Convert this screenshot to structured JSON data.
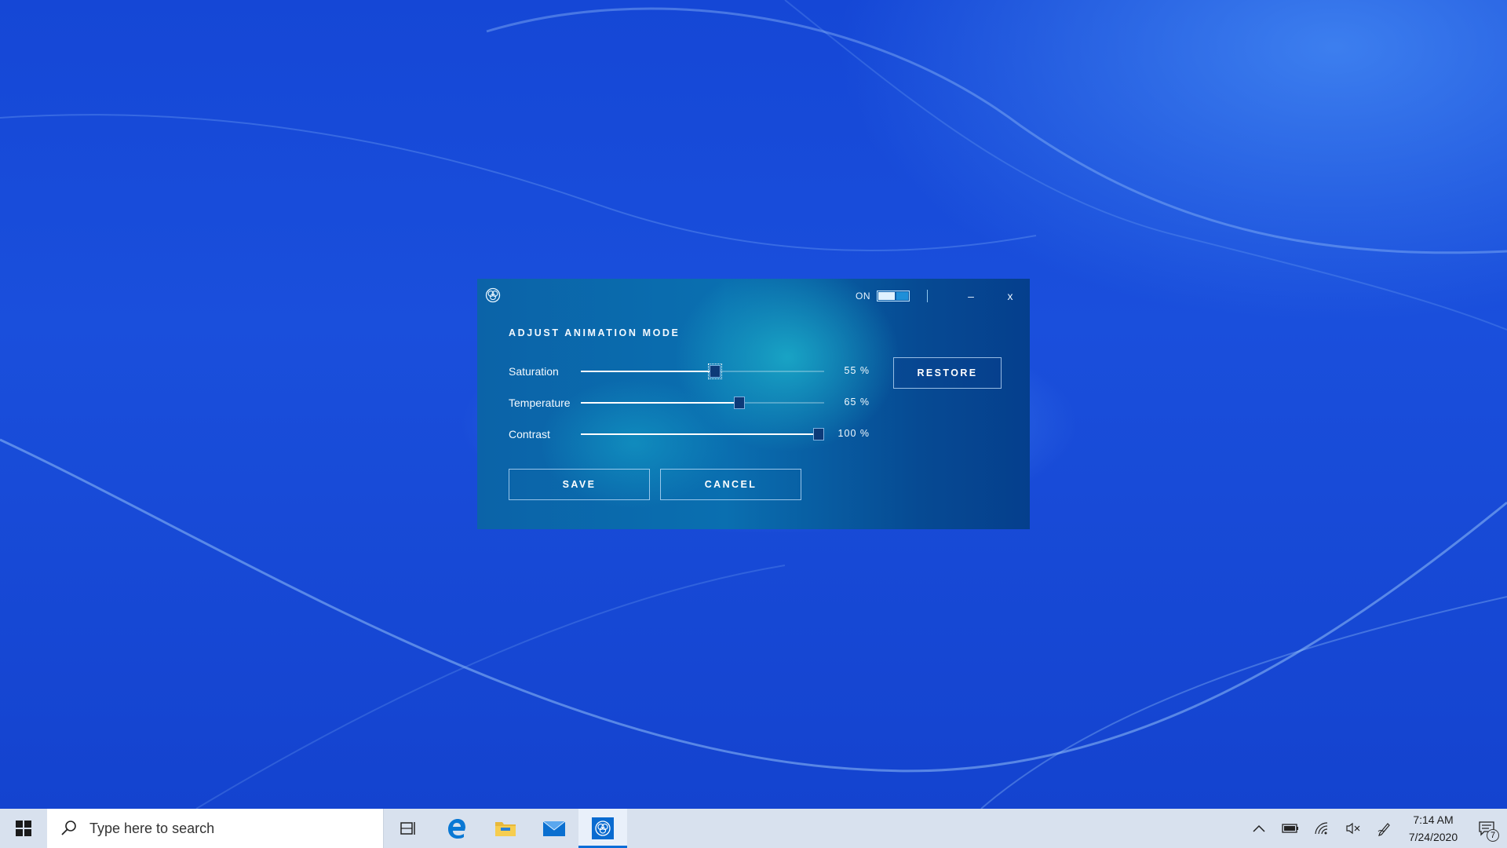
{
  "app": {
    "power_label": "ON",
    "power_on": true,
    "minimize_glyph": "–",
    "close_glyph": "x",
    "heading": "ADJUST ANIMATION MODE",
    "sliders": [
      {
        "label": "Saturation",
        "value": 55,
        "display": "55 %",
        "focused": true
      },
      {
        "label": "Temperature",
        "value": 65,
        "display": "65 %",
        "focused": false
      },
      {
        "label": "Contrast",
        "value": 100,
        "display": "100 %",
        "focused": false
      }
    ],
    "restore_label": "RESTORE",
    "save_label": "SAVE",
    "cancel_label": "CANCEL"
  },
  "taskbar": {
    "search_placeholder": "Type here to search",
    "pinned": [
      "task-view-icon",
      "edge-browser-icon",
      "file-explorer-icon",
      "mail-icon",
      "animation-app-icon"
    ],
    "active_app": "animation-app-icon",
    "tray_icons": [
      "chevron-up-icon",
      "battery-icon",
      "wifi-icon",
      "volume-muted-icon",
      "pen-icon"
    ],
    "time": "7:14 AM",
    "date": "7/24/2020",
    "notification_count": "7"
  },
  "colors": {
    "desktop_blue": "#1547d6",
    "window_teal": "#0a6fb0",
    "taskbar_bg": "#d8e1ee",
    "active_accent": "#0a6dd8"
  }
}
